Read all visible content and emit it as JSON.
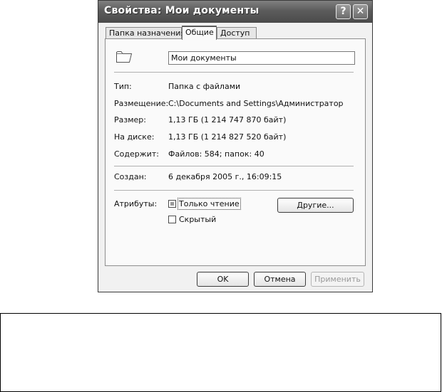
{
  "window": {
    "title": "Свойства: Мои документы",
    "help_glyph": "?",
    "close_glyph": "✕"
  },
  "tabs": [
    {
      "label": "Папка назначения",
      "active": false
    },
    {
      "label": "Общие",
      "active": true
    },
    {
      "label": "Доступ",
      "active": false
    }
  ],
  "general": {
    "name_value": "Мои документы",
    "fields": [
      {
        "label": "Тип:",
        "value": "Папка с файлами"
      },
      {
        "label": "Размещение:",
        "value": "C:\\Documents and Settings\\Администратор"
      },
      {
        "label": "Размер:",
        "value": "1,13 ГБ (1 214 747 870 байт)"
      },
      {
        "label": "На диске:",
        "value": "1,13 ГБ (1 214 827 520 байт)"
      },
      {
        "label": "Содержит:",
        "value": "Файлов: 584; папок: 40"
      }
    ],
    "created": {
      "label": "Создан:",
      "value": "6 декабря 2005 г., 16:09:15"
    },
    "attributes": {
      "label": "Атрибуты:",
      "readonly_label": "Только чтение",
      "readonly_state": "indeterminate",
      "hidden_label": "Скрытый",
      "hidden_state": "unchecked",
      "other_button": "Другие..."
    }
  },
  "buttons": {
    "ok": "OK",
    "cancel": "Отмена",
    "apply": "Применить"
  }
}
